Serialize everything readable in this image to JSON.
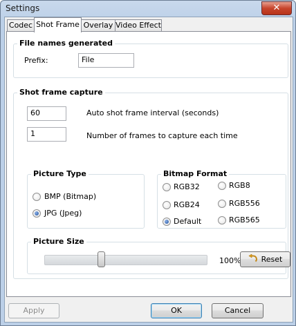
{
  "window": {
    "title": "Settings",
    "close_glyph": "✕"
  },
  "tabs": [
    {
      "label": "Codec"
    },
    {
      "label": "Shot Frame"
    },
    {
      "label": "Overlay"
    },
    {
      "label": "Video Effect"
    }
  ],
  "file_names": {
    "heading": "File names generated",
    "prefix_label": "Prefix:",
    "prefix_value": "File"
  },
  "shot_frame": {
    "heading": "Shot frame capture",
    "interval_value": "60",
    "interval_label": "Auto shot frame interval (seconds)",
    "frames_value": "1",
    "frames_label": "Number of frames to capture each time"
  },
  "picture_type": {
    "heading": "Picture Type",
    "options": [
      {
        "label": "BMP (Bitmap)",
        "checked": false
      },
      {
        "label": "JPG (Jpeg)",
        "checked": true
      }
    ]
  },
  "bitmap_format": {
    "heading": "Bitmap Format",
    "options": [
      {
        "label": "RGB32",
        "checked": false
      },
      {
        "label": "RGB8",
        "checked": false
      },
      {
        "label": "RGB24",
        "checked": false
      },
      {
        "label": "RGB556",
        "checked": false
      },
      {
        "label": "Default",
        "checked": true
      },
      {
        "label": "RGB565",
        "checked": false
      }
    ]
  },
  "picture_size": {
    "heading": "Picture Size",
    "value_label": "100%",
    "slider_fraction": 0.34,
    "reset_label": "Reset",
    "reset_icon": "undo-arrow-icon"
  },
  "buttons": {
    "apply": "Apply",
    "ok": "OK",
    "cancel": "Cancel"
  }
}
